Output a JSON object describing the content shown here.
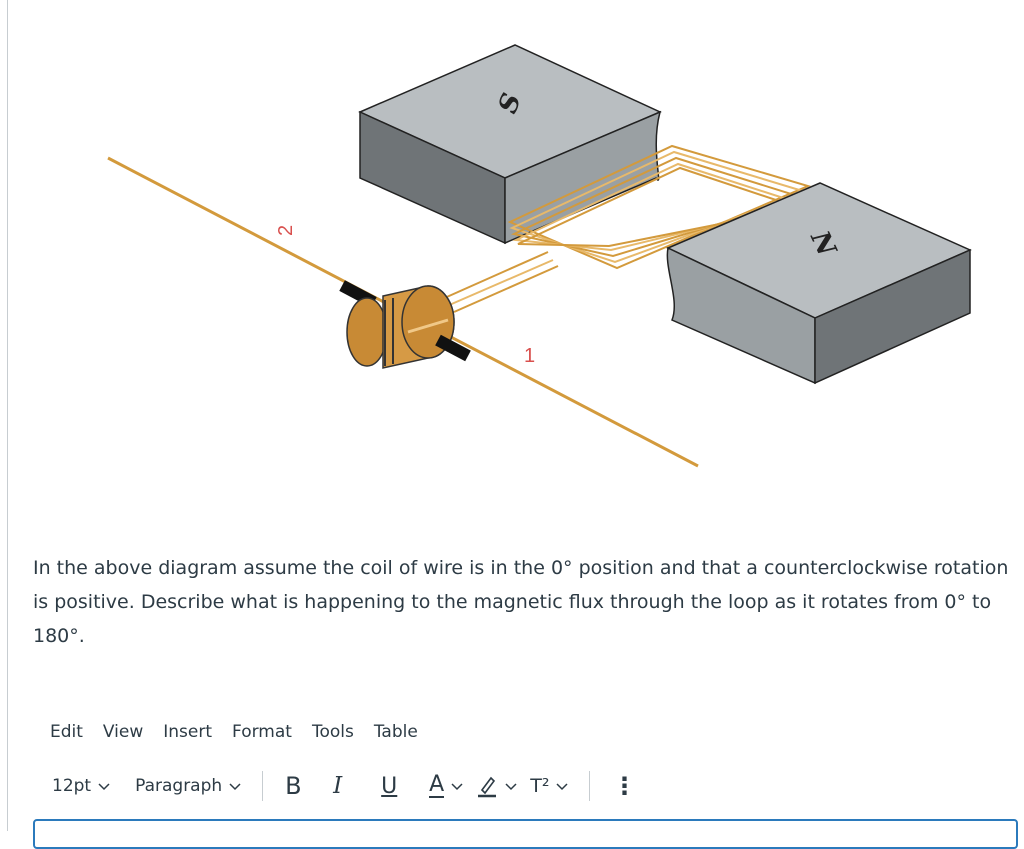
{
  "diagram": {
    "south_label": "S",
    "north_label": "N",
    "brush_label_2": "2",
    "brush_label_1": "1"
  },
  "question": {
    "text": "In the above diagram assume the coil of wire is in the 0° position and that a counterclockwise rotation is positive. Describe what is happening to the magnetic flux through the loop as it rotates from 0° to 180°."
  },
  "menubar": {
    "items": [
      "Edit",
      "View",
      "Insert",
      "Format",
      "Tools",
      "Table"
    ]
  },
  "toolbar": {
    "font_size": "12pt",
    "block_format": "Paragraph",
    "bold": "B",
    "italic": "I",
    "underline": "U",
    "text_color": "A",
    "superscript": "T²",
    "more": "⋮"
  },
  "colors": {
    "accent": "#2b7abc",
    "wire": "#d39a3c",
    "magnet_top": "#b9bec1",
    "magnet_side": "#6f7477"
  }
}
